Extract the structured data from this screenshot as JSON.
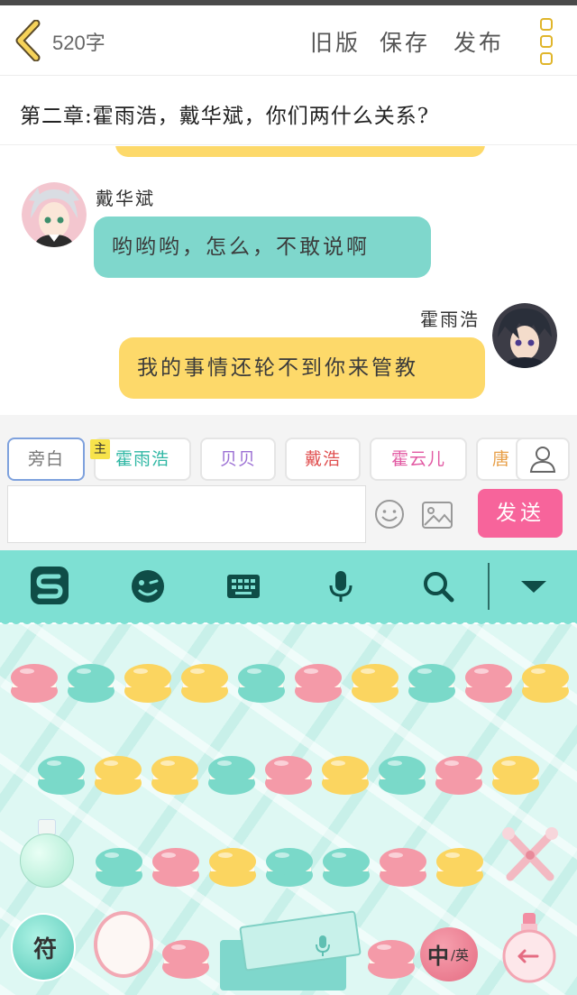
{
  "header": {
    "word_count": "520字",
    "old_version": "旧版",
    "save": "保存",
    "publish": "发布"
  },
  "chapter": {
    "title": "第二章:霍雨浩，戴华斌，你们两什么关系?"
  },
  "messages": [
    {
      "sender": "戴华斌",
      "text": "哟哟哟，怎么，不敢说啊",
      "side": "left",
      "color": "#7fd7cc"
    },
    {
      "sender": "霍雨浩",
      "text": "我的事情还轮不到你来管教",
      "side": "right",
      "color": "#fdd96a"
    }
  ],
  "roles": [
    {
      "label": "旁白",
      "color": "#777777"
    },
    {
      "label": "霍雨浩",
      "color": "#2fb7a4",
      "badge": "主"
    },
    {
      "label": "贝贝",
      "color": "#9b6fd4"
    },
    {
      "label": "戴浩",
      "color": "#e05050"
    },
    {
      "label": "霍云儿",
      "color": "#e25aa3"
    },
    {
      "label": "唐",
      "color": "#e8a04a"
    }
  ],
  "composer": {
    "input_value": "",
    "input_placeholder": "",
    "send_label": "发送"
  },
  "keyboard": {
    "symbol_key": "符",
    "lang_key_main": "中",
    "lang_key_sub": "/英",
    "key_colors": {
      "pink": "#f49aa8",
      "teal": "#7ad9c9",
      "yellow": "#fbd560"
    },
    "rows": [
      [
        "pink",
        "teal",
        "yellow",
        "yellow",
        "teal",
        "pink",
        "yellow",
        "teal",
        "pink",
        "yellow"
      ],
      [
        "teal",
        "yellow",
        "yellow",
        "teal",
        "pink",
        "yellow",
        "teal",
        "pink",
        "yellow"
      ],
      [
        "teal",
        "pink",
        "yellow",
        "teal",
        "teal",
        "pink",
        "yellow"
      ]
    ]
  },
  "colors": {
    "accent_yellow": "#e0b52a",
    "send_pink": "#f7649b",
    "toolbar_teal": "#7ee0d3"
  }
}
